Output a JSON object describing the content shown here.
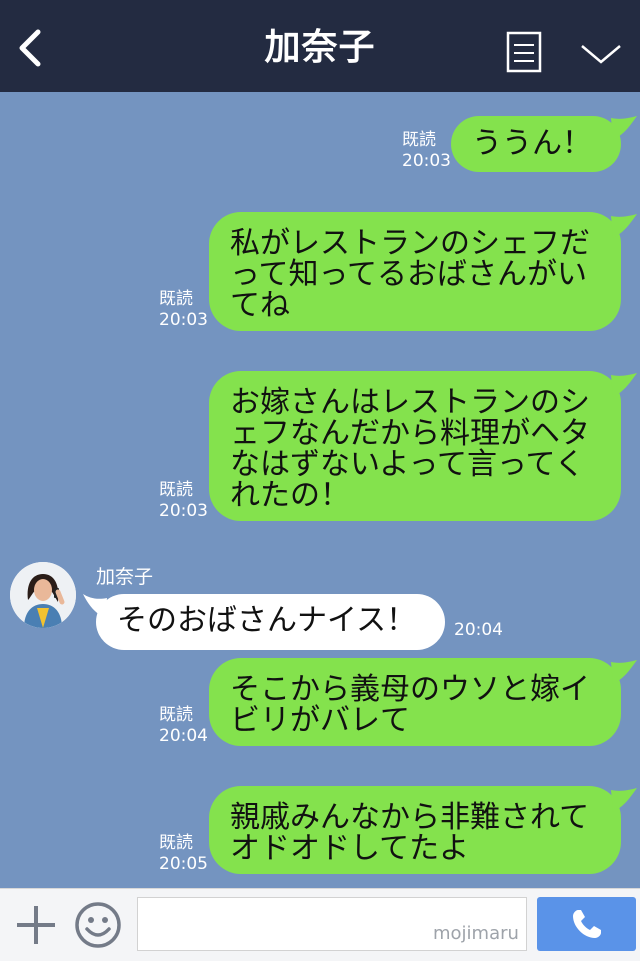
{
  "header": {
    "title": "加奈子",
    "icons": [
      "chevron-left-icon",
      "document-menu-icon",
      "chevron-down-icon"
    ]
  },
  "messages": [
    {
      "from": "me",
      "text": "ううん！",
      "read": "既読",
      "time": "20:03"
    },
    {
      "from": "me",
      "text": "私がレストランのシェフだ\nって知ってるおばさんがい\nてね",
      "read": "既読",
      "time": "20:03"
    },
    {
      "from": "me",
      "text": "お嫁さんはレストランのシ\nェフなんだから料理がヘタ\nなはずないよって言ってく\nれたの！",
      "read": "既読",
      "time": "20:03"
    },
    {
      "from": "them",
      "sender": "加奈子",
      "text": "そのおばさんナイス！",
      "time": "20:04"
    },
    {
      "from": "me",
      "text": "そこから義母のウソと嫁イ\nビリがバレて",
      "read": "既読",
      "time": "20:04"
    },
    {
      "from": "me",
      "text": "親戚みんなから非難されて\nオドオドしてたよ",
      "read": "既読",
      "time": "20:05"
    }
  ],
  "footer": {
    "icons": [
      "plus-icon",
      "smile-icon",
      "phone-icon"
    ],
    "input_value": "",
    "watermark": "mojimaru"
  },
  "colors": {
    "header_bg": "#232b41",
    "chat_bg": "#7494c0",
    "my_bubble": "#84e24d",
    "their_bubble": "#ffffff",
    "call_button": "#5a93e8"
  }
}
